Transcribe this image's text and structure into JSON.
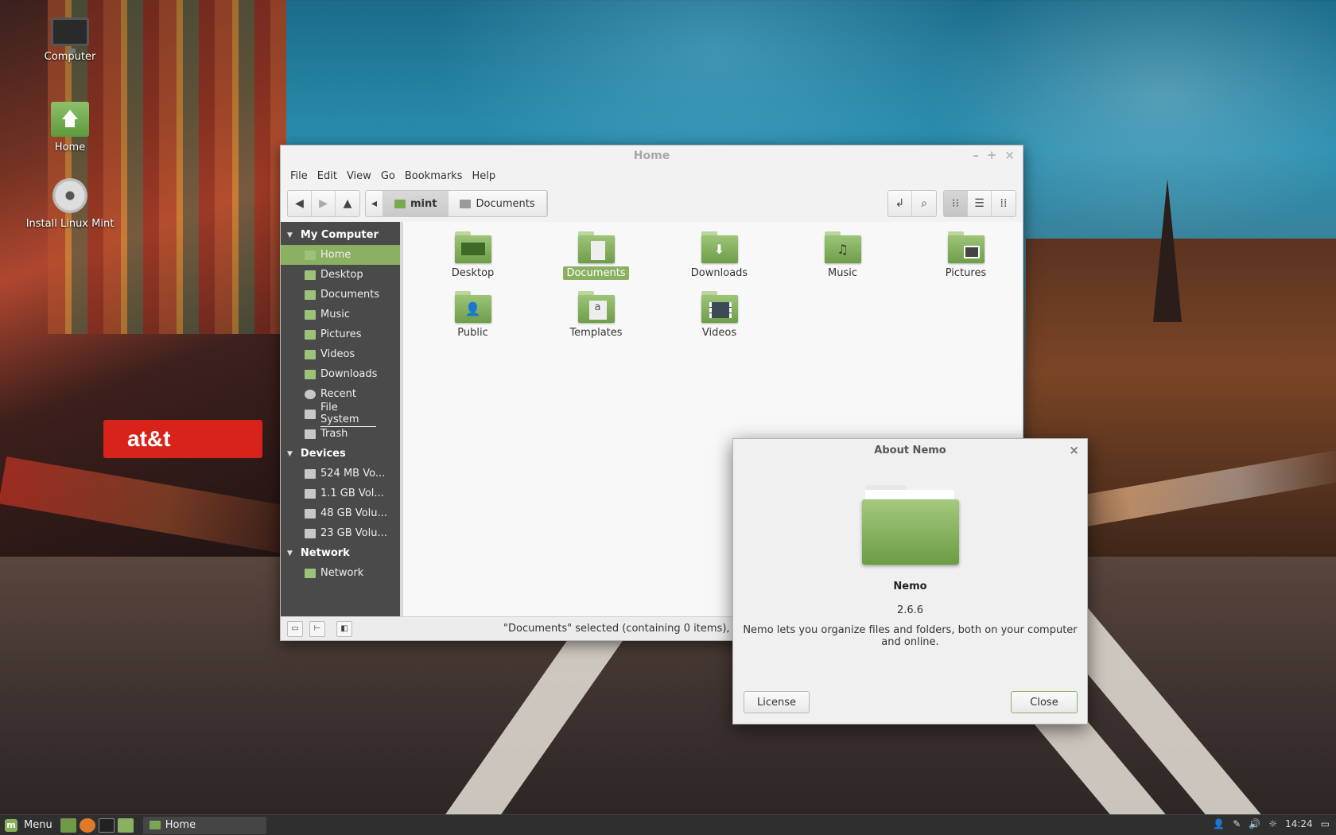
{
  "desktop": {
    "icons": [
      {
        "label": "Computer"
      },
      {
        "label": "Home"
      },
      {
        "label": "Install Linux Mint"
      }
    ]
  },
  "wallpaper": {
    "sign_text": "at&t"
  },
  "window": {
    "title": "Home",
    "controls": {
      "minimize": "–",
      "maximize": "+",
      "close": "×"
    },
    "menu": [
      "File",
      "Edit",
      "View",
      "Go",
      "Bookmarks",
      "Help"
    ],
    "breadcrumbs": [
      {
        "label": "mint",
        "active": true
      },
      {
        "label": "Documents",
        "active": false
      }
    ],
    "view_modes": [
      "icon-view",
      "list-view",
      "compact-view"
    ],
    "sidebar": {
      "sections": [
        {
          "title": "My Computer",
          "items": [
            {
              "label": "Home",
              "icon": "home-folder-icon",
              "active": true
            },
            {
              "label": "Desktop",
              "icon": "desktop-folder-icon"
            },
            {
              "label": "Documents",
              "icon": "documents-folder-icon"
            },
            {
              "label": "Music",
              "icon": "music-folder-icon"
            },
            {
              "label": "Pictures",
              "icon": "pictures-folder-icon"
            },
            {
              "label": "Videos",
              "icon": "videos-folder-icon"
            },
            {
              "label": "Downloads",
              "icon": "downloads-folder-icon"
            },
            {
              "label": "Recent",
              "icon": "recent-icon"
            },
            {
              "label": "File System",
              "icon": "filesystem-icon"
            },
            {
              "label": "Trash",
              "icon": "trash-icon"
            }
          ]
        },
        {
          "title": "Devices",
          "items": [
            {
              "label": "524 MB Vo...",
              "icon": "drive-icon"
            },
            {
              "label": "1.1 GB Vol...",
              "icon": "drive-icon"
            },
            {
              "label": "48 GB Volu...",
              "icon": "drive-icon"
            },
            {
              "label": "23 GB Volu...",
              "icon": "drive-icon"
            }
          ]
        },
        {
          "title": "Network",
          "items": [
            {
              "label": "Network",
              "icon": "network-icon"
            }
          ]
        }
      ]
    },
    "files": [
      {
        "label": "Desktop",
        "icon": "desktop-folder-icon",
        "selected": false
      },
      {
        "label": "Documents",
        "icon": "documents-folder-icon",
        "selected": true
      },
      {
        "label": "Downloads",
        "icon": "downloads-folder-icon",
        "selected": false
      },
      {
        "label": "Music",
        "icon": "music-folder-icon",
        "selected": false
      },
      {
        "label": "Pictures",
        "icon": "pictures-folder-icon",
        "selected": false
      },
      {
        "label": "Public",
        "icon": "public-folder-icon",
        "selected": false
      },
      {
        "label": "Templates",
        "icon": "templates-folder-icon",
        "selected": false
      },
      {
        "label": "Videos",
        "icon": "videos-folder-icon",
        "selected": false
      }
    ],
    "status": "\"Documents\" selected (containing 0 items), Free spa"
  },
  "about": {
    "title": "About Nemo",
    "name": "Nemo",
    "version": "2.6.6",
    "description": "Nemo lets you organize files and folders, both on your computer and online.",
    "license_label": "License",
    "close_label": "Close"
  },
  "panel": {
    "menu_label": "Menu",
    "task_label": "Home",
    "clock": "14:24"
  },
  "colors": {
    "accent": "#8ab062",
    "sidebar_bg": "#4a4a4a",
    "panel_bg": "#2f2f2f"
  }
}
